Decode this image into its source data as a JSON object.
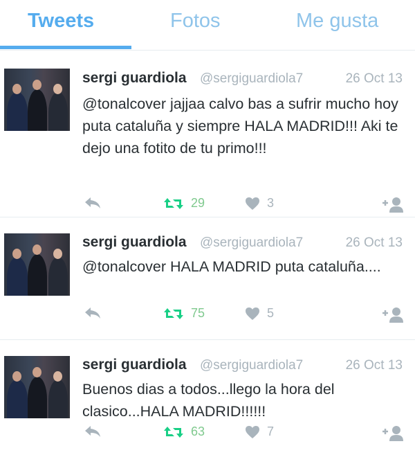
{
  "tabs": [
    {
      "label": "Tweets",
      "active": true
    },
    {
      "label": "Fotos",
      "active": false
    },
    {
      "label": "Me gusta",
      "active": false
    }
  ],
  "colors": {
    "accent": "#55acee",
    "retweet_green": "#19cf86",
    "muted_gray": "#a9b4bc",
    "text": "#292f33"
  },
  "tweets": [
    {
      "name": "sergi guardiola",
      "handle": "@sergiguardiola7",
      "date": "26 Oct 13",
      "text": "@tonalcover jajjaa calvo bas a sufrir mucho hoy puta cataluña y siempre HALA MADRID!!! Aki te dejo una fotito de tu primo!!!",
      "retweets": "29",
      "likes": "3"
    },
    {
      "name": "sergi guardiola",
      "handle": "@sergiguardiola7",
      "date": "26 Oct 13",
      "text": "@tonalcover HALA MADRID puta cataluña....",
      "retweets": "75",
      "likes": "5"
    },
    {
      "name": "sergi guardiola",
      "handle": "@sergiguardiola7",
      "date": "26 Oct 13",
      "text": "Buenos dias a todos...llego la hora del clasico...HALA MADRID!!!!!!",
      "retweets": "63",
      "likes": "7"
    }
  ],
  "icons": {
    "reply": "reply-icon",
    "retweet": "retweet-icon",
    "like": "heart-icon",
    "follow": "follow-user-icon"
  }
}
